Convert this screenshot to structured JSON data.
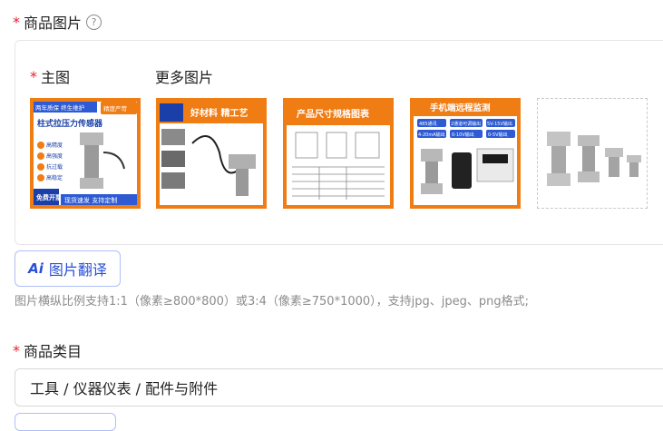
{
  "image_section": {
    "label": "商品图片",
    "help": "?"
  },
  "main_image": {
    "label": "主图"
  },
  "more_images": {
    "label": "更多图片"
  },
  "thumbnails": [
    {
      "title_top": "两年质保 终生维护",
      "badge": "精度严苛",
      "headline": "柱式拉压力传感器",
      "bullets": [
        "高精度",
        "高强度",
        "抗过载",
        "高稳定",
        "长寿命"
      ],
      "bottom_left": "免费开票",
      "bottom_right": "现货速发 支持定制"
    },
    {
      "headline": "好材料 精工艺"
    },
    {
      "headline": "产品尺寸规格图表"
    },
    {
      "headline": "手机端远程监测",
      "chips": [
        "485通讯",
        "2通道可调输出",
        "5V-15V输出",
        "4-20mA输出",
        "0-10V输出",
        "0-5V输出"
      ]
    },
    {}
  ],
  "translate_button": {
    "icon": "Ai",
    "label": "图片翻译"
  },
  "hint_text": "图片横纵比例支持1:1（像素≥800*800）或3:4（像素≥750*1000），支持jpg、jpeg、png格式;",
  "category_section": {
    "label": "商品类目",
    "value": "工具 / 仪器仪表 / 配件与附件"
  },
  "colors": {
    "accent": "#f07c14",
    "required": "#e8212f",
    "link_blue": "#2a4fd8"
  }
}
